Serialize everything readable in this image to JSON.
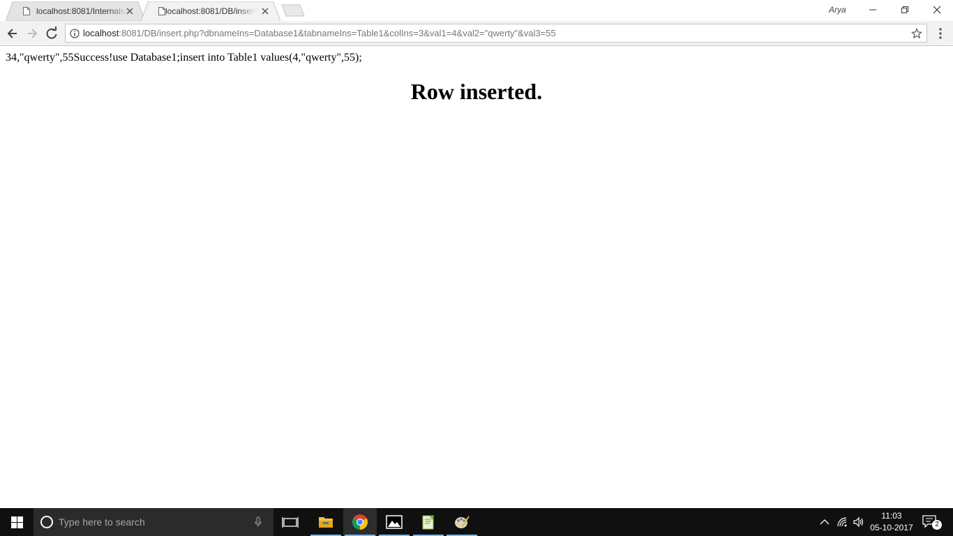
{
  "browser": {
    "profile_name": "Arya",
    "tabs": [
      {
        "title": "localhost:8081/Internals/",
        "active": false
      },
      {
        "title": "localhost:8081/DB/insert.php",
        "active": true
      }
    ],
    "address_bar": {
      "host": "localhost",
      "rest": ":8081/DB/insert.php?dbnameIns=Database1&tabnameIns=Table1&colIns=3&val1=4&val2=\"qwerty\"&val3=55"
    }
  },
  "page": {
    "output_line": "34,\"qwerty\",55Success!use Database1;insert into Table1 values(4,\"qwerty\",55);",
    "heading": "Row inserted."
  },
  "taskbar": {
    "search_placeholder": "Type here to search",
    "apps": [
      "task-view",
      "file-explorer",
      "chrome",
      "photos",
      "notepad-plus-plus",
      "paint"
    ],
    "time": "11:03",
    "date": "05-10-2017",
    "notification_count": "2",
    "accent_color": "#76b9ed"
  }
}
